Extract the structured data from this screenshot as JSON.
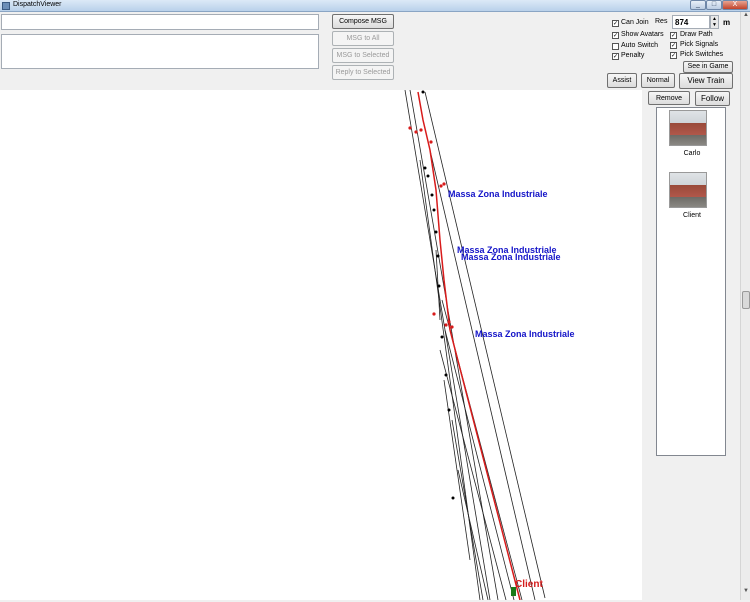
{
  "window": {
    "title": "DispatchViewer",
    "min_glyph": "_",
    "max_glyph": "□",
    "close_glyph": "X"
  },
  "message_panel": {
    "top_field_value": "",
    "message_field_value": ""
  },
  "buttons": {
    "compose": "Compose MSG",
    "msg_all": "MSG to All",
    "msg_selected": "MSG to Selected",
    "reply_selected": "Reply to Selected",
    "see_in_game": "See in Game",
    "assist": "Assist",
    "normal": "Normal",
    "view_train": "View Train",
    "remove": "Remove",
    "follow": "Follow"
  },
  "options": {
    "can_join": {
      "label": "Can Join",
      "checked": true
    },
    "show_avatars": {
      "label": "Show Avatars",
      "checked": true
    },
    "auto_switch": {
      "label": "Auto Switch",
      "checked": false
    },
    "penalty": {
      "label": "Penalty",
      "checked": true
    },
    "draw_path": {
      "label": "Draw Path",
      "checked": true
    },
    "pick_signals": {
      "label": "Pick Signals",
      "checked": true
    },
    "pick_switches": {
      "label": "Pick Switches",
      "checked": true
    }
  },
  "res": {
    "label": "Res",
    "value": "874",
    "unit": "m"
  },
  "trains": [
    {
      "name": "Carlo"
    },
    {
      "name": "Client"
    }
  ],
  "map": {
    "labels": [
      "Massa Zona Industriale",
      "Massa Zona Industriale",
      "Massa Zona Industriale",
      "Massa Zona Industriale"
    ],
    "train_label": "Client",
    "colors": {
      "track": "#222222",
      "path": "#d81b1b",
      "label": "#1414c8",
      "signal": "#000000",
      "train": "#1a7a1a"
    }
  },
  "check_glyph": "✓"
}
